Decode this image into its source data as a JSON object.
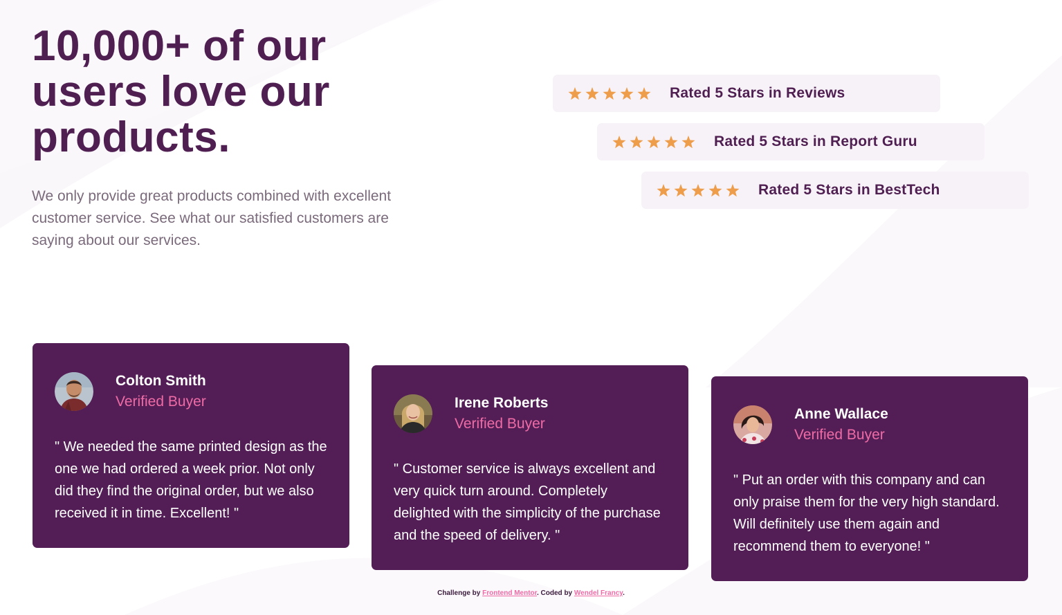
{
  "hero": {
    "title": "10,000+ of our users love our products.",
    "description": "We only provide great products combined with excellent customer service. See what our satisfied customers are saying about our services."
  },
  "ratings": [
    {
      "label": "Rated 5 Stars in Reviews",
      "stars": 5
    },
    {
      "label": "Rated 5 Stars in Report Guru",
      "stars": 5
    },
    {
      "label": "Rated 5 Stars in BestTech",
      "stars": 5
    }
  ],
  "testimonials": [
    {
      "name": "Colton Smith",
      "role": "Verified Buyer",
      "quote": "\" We needed the same printed design as the one we had ordered a week prior. Not only did they find the original order, but we also received it in time. Excellent! \"",
      "avatar_icon": "person-avatar-icon"
    },
    {
      "name": "Irene Roberts",
      "role": "Verified Buyer",
      "quote": "\" Customer service is always excellent and very quick turn around. Completely delighted with the simplicity of the purchase and the speed of delivery. \"",
      "avatar_icon": "person-avatar-icon"
    },
    {
      "name": "Anne Wallace",
      "role": "Verified Buyer",
      "quote": "\" Put an order with this company and can only praise them for the very high standard. Will definitely use them again and recommend them to everyone! \"",
      "avatar_icon": "person-avatar-icon"
    }
  ],
  "footer": {
    "prefix": "Challenge by ",
    "link1": "Frontend Mentor",
    "middle": ". Coded by ",
    "link2": "Wendel Francy",
    "suffix": "."
  },
  "colors": {
    "primary": "#4f1f52",
    "card_bg": "#531e55",
    "accent_pink": "#ee6ba6",
    "star": "#ee9d4b",
    "rating_bg": "#f7f2f7",
    "muted_text": "#7a6a7b"
  }
}
